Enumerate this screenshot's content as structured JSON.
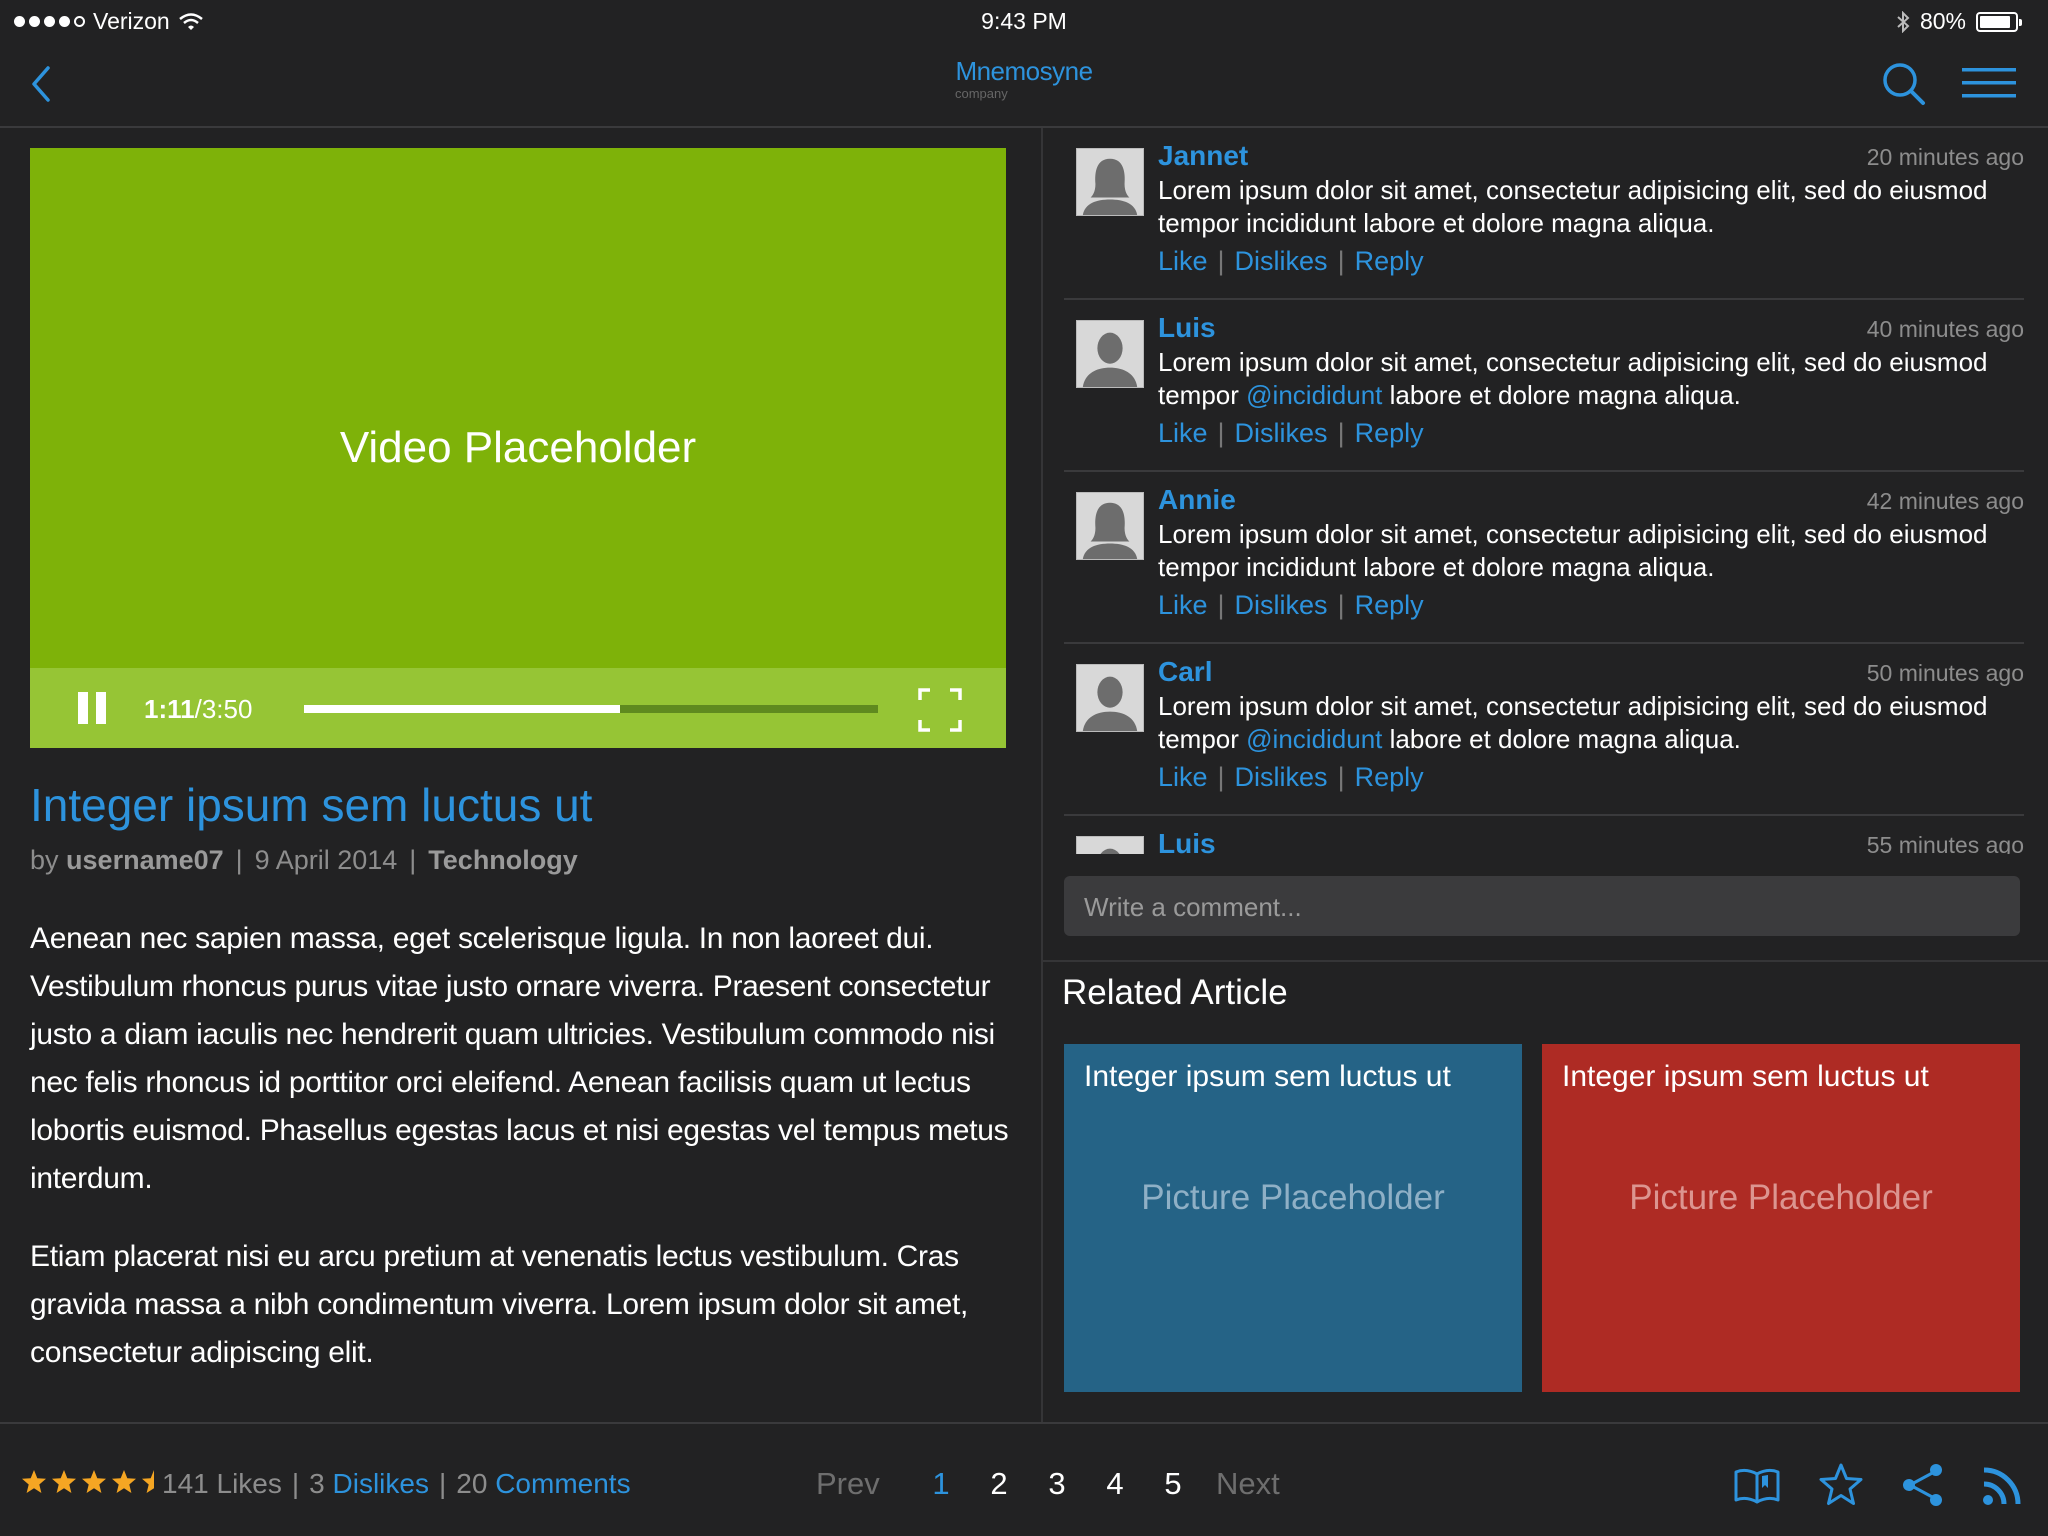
{
  "status_bar": {
    "carrier": "Verizon",
    "time": "9:43 PM",
    "battery": "80%"
  },
  "header": {
    "logo": "Mnemosyne",
    "logo_sub": "company"
  },
  "video": {
    "placeholder": "Video Placeholder",
    "elapsed": "1:11",
    "total": "/3:50",
    "progress": 0.55
  },
  "article": {
    "title": "Integer ipsum sem luctus ut",
    "by": "by",
    "author": "username07",
    "date": "9 April 2014",
    "category": "Technology",
    "paragraphs": [
      "Aenean nec sapien massa, eget scelerisque ligula. In non laoreet dui. Vestibulum rhoncus purus vitae justo ornare viverra. Praesent consectetur justo a diam iaculis nec hendrerit quam ultricies. Vestibulum commodo nisi nec felis rhoncus id porttitor orci eleifend. Aenean facilisis quam ut lectus lobortis euismod. Phasellus egestas lacus et nisi egestas vel tempus metus interdum.",
      "Etiam placerat nisi eu arcu pretium at venenatis lectus vestibulum. Cras gravida massa a nibh condimentum viverra. Lorem ipsum dolor sit amet, consectetur adipiscing elit."
    ]
  },
  "comments": [
    {
      "name": "Jannet",
      "time": "20 minutes ago",
      "avatar": "female",
      "text_before": "Lorem ipsum dolor sit amet, consectetur adipisicing elit, sed do eiusmod tempor incididunt labore et dolore magna aliqua.",
      "mention": "",
      "text_after": ""
    },
    {
      "name": "Luis",
      "time": "40 minutes ago",
      "avatar": "male",
      "text_before": "Lorem ipsum dolor sit amet, consectetur adipisicing elit, sed do eiusmod tempor ",
      "mention": "@incididunt",
      "text_after": " labore et dolore magna aliqua."
    },
    {
      "name": "Annie",
      "time": "42 minutes ago",
      "avatar": "female",
      "text_before": "Lorem ipsum dolor sit amet, consectetur adipisicing elit, sed do eiusmod tempor incididunt labore et dolore magna aliqua.",
      "mention": "",
      "text_after": ""
    },
    {
      "name": "Carl",
      "time": "50 minutes ago",
      "avatar": "male",
      "text_before": "Lorem ipsum dolor sit amet, consectetur adipisicing elit, sed do eiusmod tempor ",
      "mention": "@incididunt",
      "text_after": " labore et dolore magna aliqua."
    },
    {
      "name": "Luis",
      "time": "55 minutes ago",
      "avatar": "male",
      "text_before": "",
      "mention": "",
      "text_after": ""
    }
  ],
  "comment_actions": {
    "like": "Like",
    "dislikes": "Dislikes",
    "reply": "Reply"
  },
  "comment_input": {
    "placeholder": "Write a comment..."
  },
  "related": {
    "heading": "Related Article",
    "cards": [
      {
        "title": "Integer ipsum sem luctus ut",
        "placeholder": "Picture Placeholder",
        "color": "#256386"
      },
      {
        "title": "Integer ipsum sem luctus ut",
        "placeholder": "Picture Placeholder",
        "color": "#ae2b24"
      }
    ]
  },
  "footer": {
    "rating": 4.5,
    "likes": "141 Likes",
    "dislikes_count": "3",
    "dislikes_label": "Dislikes",
    "comments_count": "20",
    "comments_label": "Comments",
    "prev": "Prev",
    "pages": [
      "1",
      "2",
      "3",
      "4",
      "5"
    ],
    "active_page": "1",
    "next": "Next",
    "icons": [
      "book-icon",
      "star-icon",
      "share-icon",
      "rss-icon"
    ]
  },
  "colors": {
    "accent": "#2d93dd",
    "background": "#222223",
    "video": "#7eb209",
    "star": "#f5a623"
  }
}
